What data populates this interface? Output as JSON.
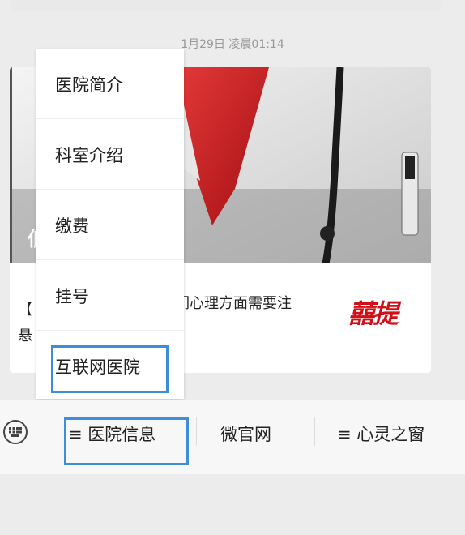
{
  "timestamp": "1月29日 凌晨01:14",
  "card": {
    "image_overlay_text": "低",
    "text_partial": "我们心理方面需要注",
    "edge_char_top": "【",
    "edge_char_bottom": "悬",
    "logo_text": "囍提"
  },
  "menu": {
    "items": [
      {
        "label": "医院简介"
      },
      {
        "label": "科室介绍"
      },
      {
        "label": "缴费"
      },
      {
        "label": "挂号"
      },
      {
        "label": "互联网医院"
      }
    ]
  },
  "bottom_bar": {
    "tabs": [
      {
        "label": "≡ 医院信息"
      },
      {
        "label": "微官网"
      },
      {
        "label": "≡ 心灵之窗"
      }
    ]
  },
  "colors": {
    "highlight": "#3d8ddb",
    "logo_red": "#d10f17"
  }
}
